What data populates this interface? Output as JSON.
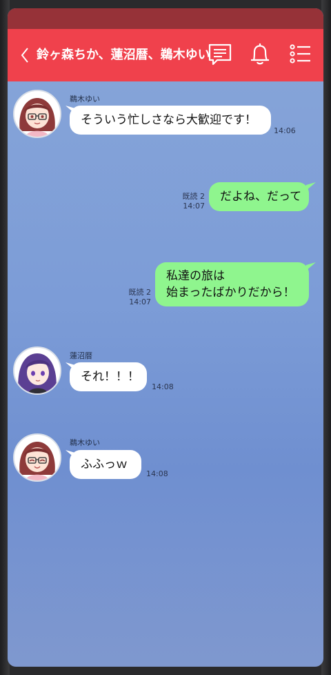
{
  "header": {
    "title": "鈴ヶ森ちか、蓮沼暦、鵜木ゆい"
  },
  "colors": {
    "header": "#f0414c",
    "status_bar": "#963238",
    "incoming_bubble": "#ffffff",
    "outgoing_bubble": "#8ff58e"
  },
  "icons": {
    "back": "chevron-left-icon",
    "chat": "chat-list-icon",
    "bell": "bell-icon",
    "menu": "menu-list-icon"
  },
  "messages": [
    {
      "direction": "in",
      "sender": "鵜木ゆい",
      "text": "そういう忙しさなら大歓迎です！",
      "time": "14:06"
    },
    {
      "direction": "out",
      "read": "既読 2",
      "text": "だよね、だって",
      "time": "14:07"
    },
    {
      "direction": "out",
      "read": "既読 2",
      "lines": [
        "私達の旅は",
        "始まったばかりだから！"
      ],
      "time": "14:07"
    },
    {
      "direction": "in",
      "sender": "蓮沼暦",
      "text": "それ！！！",
      "time": "14:08"
    },
    {
      "direction": "in",
      "sender": "鵜木ゆい",
      "text": "ふふっｗ",
      "time": "14:08"
    }
  ]
}
